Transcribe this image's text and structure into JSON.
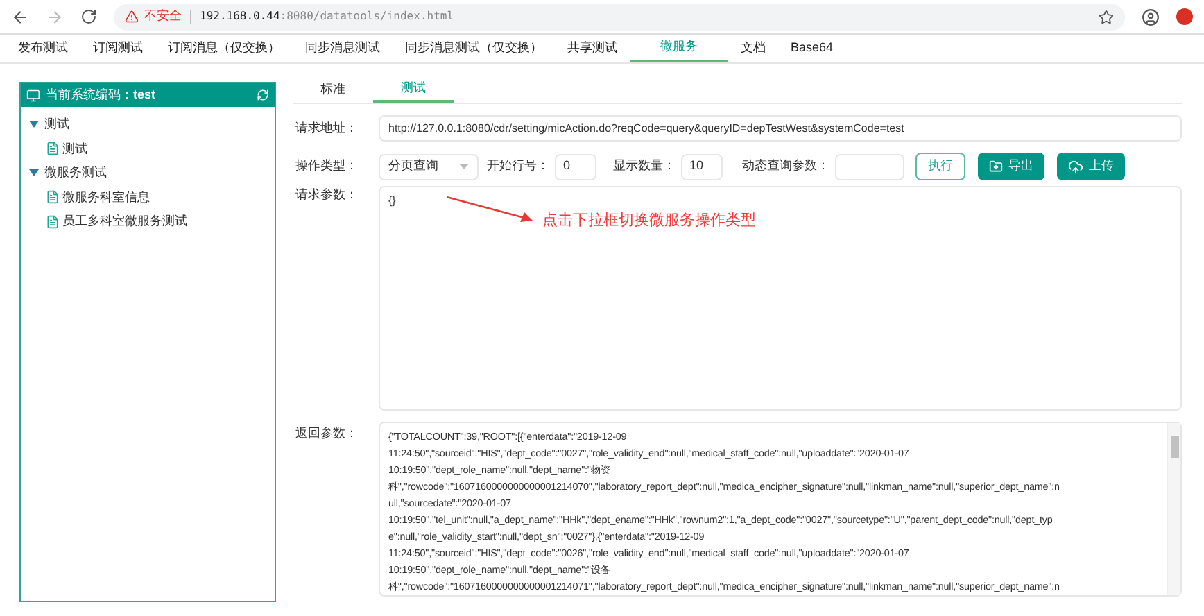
{
  "browser": {
    "security_label": "不安全",
    "url_host": "192.168.0.44",
    "url_path": ":8080/datatools/index.html"
  },
  "nav_tabs": [
    {
      "label": "发布测试",
      "selected": false
    },
    {
      "label": "订阅测试",
      "selected": false
    },
    {
      "label": "订阅消息（仅交换）",
      "selected": false
    },
    {
      "label": "同步消息测试",
      "selected": false
    },
    {
      "label": "同步消息测试（仅交换）",
      "selected": false
    },
    {
      "label": "共享测试",
      "selected": false
    },
    {
      "label": "微服务",
      "selected": true
    },
    {
      "label": "文档",
      "selected": false
    },
    {
      "label": "Base64",
      "selected": false
    }
  ],
  "tree_panel": {
    "title_label": "当前系统编码：",
    "title_code": "test",
    "nodes": [
      {
        "label": "测试",
        "expanded": true,
        "children": [
          {
            "label": "测试"
          }
        ]
      },
      {
        "label": "微服务测试",
        "expanded": true,
        "children": [
          {
            "label": "微服务科室信息"
          },
          {
            "label": "员工多科室微服务测试"
          }
        ]
      }
    ]
  },
  "sub_tabs": [
    {
      "label": "标准",
      "selected": false
    },
    {
      "label": "测试",
      "selected": true
    }
  ],
  "form": {
    "request_url": {
      "label": "请求地址：",
      "value": "http://127.0.0.1:8080/cdr/setting/micAction.do?reqCode=query&queryID=depTestWest&systemCode=test"
    },
    "operation_type": {
      "label": "操作类型：",
      "value": "分页查询"
    },
    "start_row": {
      "label": "开始行号：",
      "value": "0"
    },
    "display_count": {
      "label": "显示数量：",
      "value": "10"
    },
    "dynamic_params": {
      "label": "动态查询参数："
    },
    "buttons": [
      {
        "label": "执行",
        "kind": "outline"
      },
      {
        "label": "导出",
        "kind": "export"
      },
      {
        "label": "上传",
        "kind": "upload"
      }
    ],
    "request_params": {
      "label": "请求参数：",
      "value": "{}"
    },
    "annotation": "点击下拉框切换微服务操作类型",
    "response": {
      "label": "返回参数：",
      "lines": [
        "{\"TOTALCOUNT\":39,\"ROOT\":[{\"enterdata\":\"2019-12-09",
        "11:24:50\",\"sourceid\":\"HIS\",\"dept_code\":\"0027\",\"role_validity_end\":null,\"medical_staff_code\":null,\"uploaddate\":\"2020-01-07",
        "10:19:50\",\"dept_role_name\":null,\"dept_name\":\"物资",
        "科\",\"rowcode\":\"1607160000000000001214070\",\"laboratory_report_dept\":null,\"medica_encipher_signature\":null,\"linkman_name\":null,\"superior_dept_name\":n",
        "ull,\"sourcedate\":\"2020-01-07",
        "10:19:50\",\"tel_unit\":null,\"a_dept_name\":\"HHk\",\"dept_ename\":\"HHk\",\"rownum2\":1,\"a_dept_code\":\"0027\",\"sourcetype\":\"U\",\"parent_dept_code\":null,\"dept_typ",
        "e\":null,\"role_validity_start\":null,\"dept_sn\":\"0027\"},{\"enterdata\":\"2019-12-09",
        "11:24:50\",\"sourceid\":\"HIS\",\"dept_code\":\"0026\",\"role_validity_end\":null,\"medical_staff_code\":null,\"uploaddate\":\"2020-01-07",
        "10:19:50\",\"dept_role_name\":null,\"dept_name\":\"设备",
        "科\",\"rowcode\":\"1607160000000000001214071\",\"laboratory_report_dept\":null,\"medica_encipher_signature\":null,\"linkman_name\":null,\"superior_dept_name\":n"
      ]
    }
  }
}
